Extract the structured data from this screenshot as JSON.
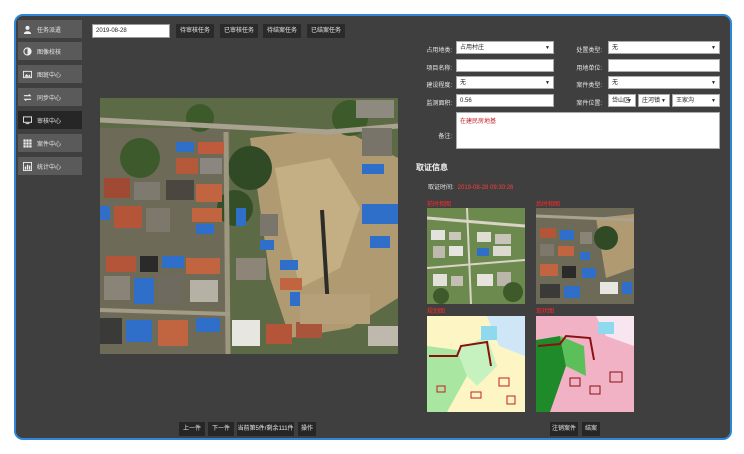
{
  "sidebar": {
    "items": [
      {
        "label": "任务派遣",
        "icon": "user-icon",
        "active": false
      },
      {
        "label": "图像校核",
        "icon": "contrast-icon",
        "active": false
      },
      {
        "label": "图斑中心",
        "icon": "image-icon",
        "active": false
      },
      {
        "label": "同步中心",
        "icon": "sync-icon",
        "active": false
      },
      {
        "label": "审核中心",
        "icon": "monitor-icon",
        "active": true
      },
      {
        "label": "案件中心",
        "icon": "grid-icon",
        "active": false
      },
      {
        "label": "统计中心",
        "icon": "chart-icon",
        "active": false
      }
    ]
  },
  "toolbar": {
    "date_value": "2019-08-28",
    "buttons": [
      "待审核任务",
      "已审核任务",
      "待结案任务",
      "已结案任务"
    ]
  },
  "pagination": {
    "prev": "上一件",
    "next": "下一件",
    "status": "当前第5件/剩余111件",
    "action": "操作"
  },
  "form": {
    "occupied_type": {
      "label": "占用地类:",
      "value": "占用村庄"
    },
    "handling_type": {
      "label": "处置类型:",
      "value": "无"
    },
    "project_name": {
      "label": "项目名称:",
      "value": ""
    },
    "land_user": {
      "label": "用地单位:",
      "value": ""
    },
    "build_stage": {
      "label": "建设程度:",
      "value": "无"
    },
    "case_type": {
      "label": "案件类型:",
      "value": "无"
    },
    "monitor_area": {
      "label": "监测面积:",
      "value": "0.56"
    },
    "case_location": {
      "label": "案件位置:",
      "district": "岱山区",
      "town": "庄河镇",
      "village": "王家沟"
    },
    "remarks": {
      "label": "备注:",
      "value": "在建民房地基"
    }
  },
  "evidence": {
    "title": "取证信息",
    "time_label": "取证时间:",
    "time_value": "2019-08-28 09:30:26",
    "images": [
      {
        "label": "前时相图"
      },
      {
        "label": "后时相图"
      },
      {
        "label": "规划图"
      },
      {
        "label": "现状图"
      }
    ]
  },
  "footer": {
    "cancel_case": "注销案件",
    "close_case": "结案"
  },
  "colors": {
    "frame_border": "#2f87d6",
    "panel_bg": "#3f3f3f",
    "button_bg": "#262626",
    "accent_red": "#ff2a2a"
  }
}
